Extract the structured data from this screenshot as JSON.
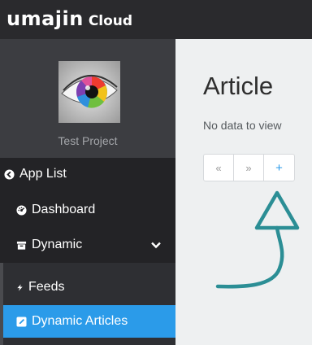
{
  "header": {
    "brand": "umajin",
    "brand_suffix": "Cloud"
  },
  "project": {
    "name": "Test Project",
    "image_icon": "colorful-eye-image"
  },
  "nav": {
    "app_list": "App List",
    "dashboard": "Dashboard",
    "dynamic": "Dynamic",
    "feeds": "Feeds",
    "dynamic_articles": "Dynamic Articles"
  },
  "content": {
    "title": "Article",
    "empty_message": "No data to view",
    "pager": {
      "prev": "«",
      "next": "»",
      "add": "+"
    }
  },
  "colors": {
    "topbar": "#2a2a2d",
    "sidebar": "#3a3b3f",
    "nav": "#232326",
    "active": "#2b9be9",
    "annotation_arrow": "#2b8e95",
    "content_bg": "#eef0f1"
  },
  "icons": {
    "app_list": "circle-arrow-left-icon",
    "dashboard": "dashboard-icon",
    "dynamic": "archive-icon",
    "dynamic_toggle": "chevron-down-icon",
    "feeds": "bolt-icon",
    "dynamic_articles": "edit-square-icon"
  }
}
